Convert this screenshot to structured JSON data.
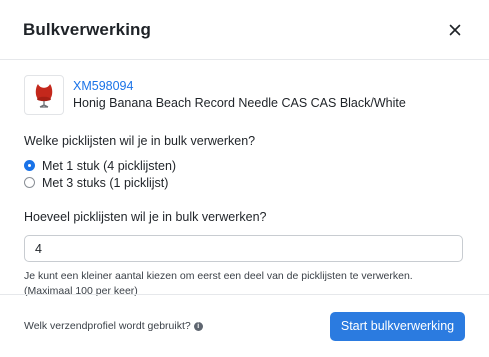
{
  "modal": {
    "title": "Bulkverwerking",
    "close_icon": "close-icon"
  },
  "product": {
    "image_icon": "egg-chair-thumbnail",
    "sku": "XM598094",
    "name": "Honig Banana Beach Record Needle CAS CAS Black/White"
  },
  "picklists_question": "Welke picklijsten wil je in bulk verwerken?",
  "options": [
    {
      "label": "Met 1 stuk (4 picklijsten)",
      "checked": true
    },
    {
      "label": "Met 3 stuks (1 picklijst)",
      "checked": false
    }
  ],
  "count_question": "Hoeveel picklijsten wil je in bulk verwerken?",
  "count_input": {
    "value": "4"
  },
  "hint": "Je kunt een kleiner aantal kiezen om eerst een deel van de picklijsten te verwerken. (Maximaal 100 per keer)",
  "footer": {
    "profile_question": "Welk verzendprofiel wordt gebruikt?",
    "info_icon": "info-icon",
    "start_button": "Start bulkverwerking"
  },
  "colors": {
    "accent": "#2b7be0",
    "link": "#1a73e8",
    "chair_red": "#c4281c"
  }
}
